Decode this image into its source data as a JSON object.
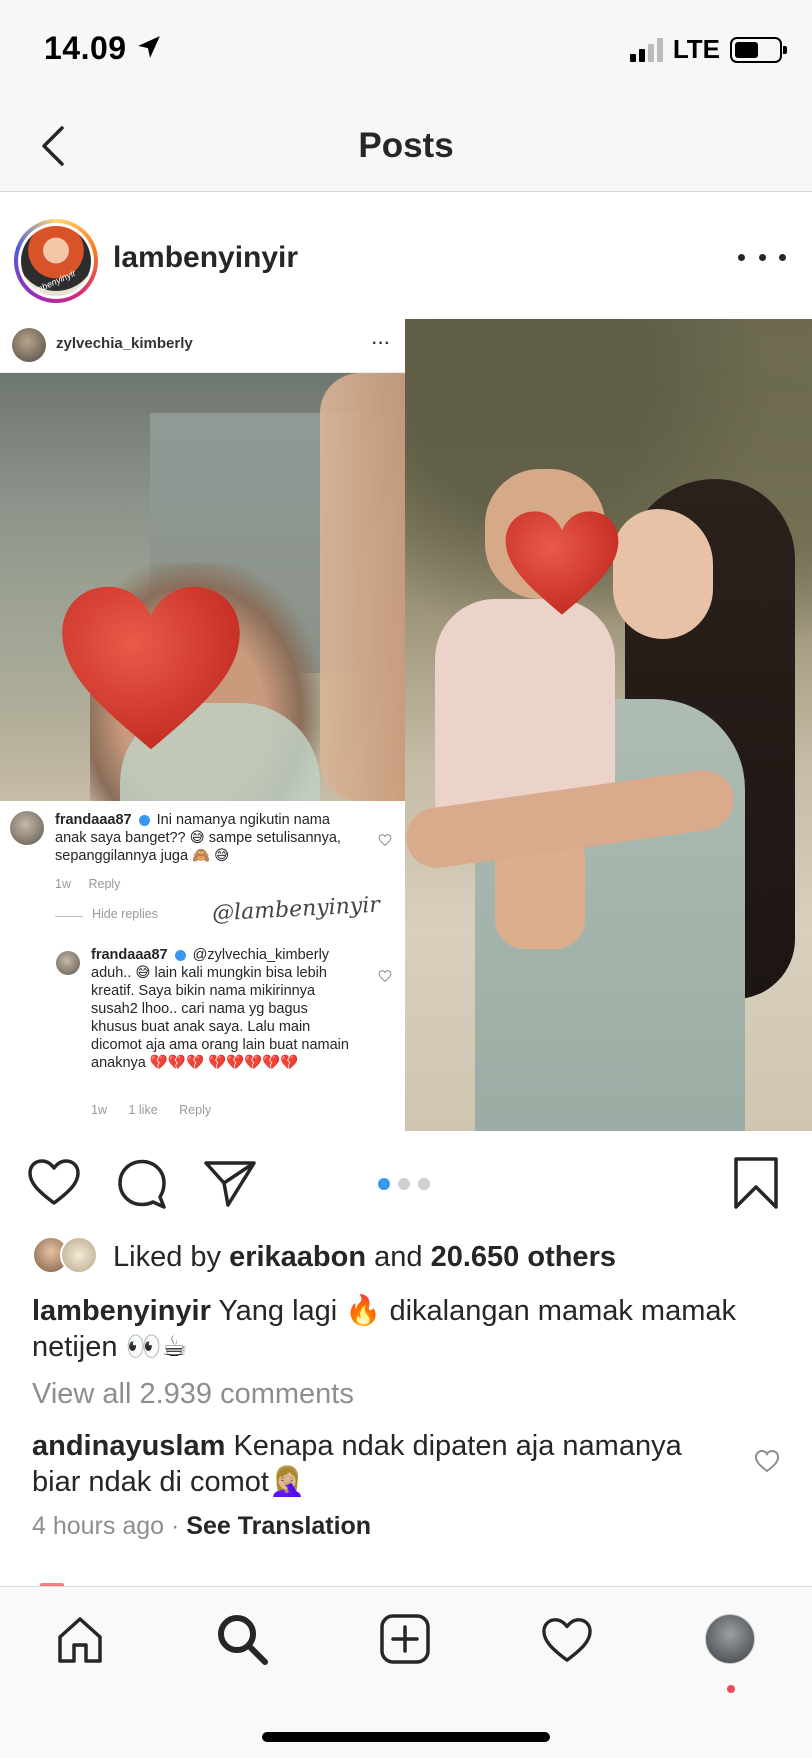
{
  "status_bar": {
    "time": "14.09",
    "network": "LTE"
  },
  "nav": {
    "title": "Posts"
  },
  "post": {
    "username": "lambenyinyir",
    "avatar_tag": "lambenyinyir",
    "media": {
      "left_panel": {
        "username": "zylvechia_kimberly",
        "more": "···",
        "comments": [
          {
            "user": "frandaaa87",
            "text": "Ini namanya ngikutin nama anak saya banget?? 😅 sampe setulisannya, sepanggilannya juga 🙈 😅",
            "time": "1w",
            "reply": "Reply"
          },
          {
            "user": "frandaaa87",
            "mention": "@zylvechia_kimberly",
            "text": "aduh.. 😅 lain kali mungkin bisa lebih kreatif. Saya bikin nama mikirinnya susah2 lhoo.. cari nama yg bagus khusus buat anak saya. Lalu main dicomot aja ama orang lain buat namain anaknya 💔💔💔 💔💔💔💔💔",
            "time": "1w",
            "likes": "1 like",
            "reply": "Reply"
          }
        ],
        "hide_replies": "Hide replies",
        "watermark": "@lambenyinyir"
      },
      "carousel": {
        "count": 3,
        "active_index": 0
      }
    },
    "likes": {
      "prefix": "Liked by",
      "user": "erikaabon",
      "joiner": "and",
      "others": "20.650 others"
    },
    "caption": {
      "user": "lambenyinyir",
      "text": "Yang lagi 🔥 dikalangan mamak mamak netijen 👀☕"
    },
    "view_all": "View all 2.939 comments",
    "top_comment": {
      "user": "andinayuslam",
      "text": "Kenapa ndak dipaten aja namanya biar ndak di comot🤦🏼‍♀️",
      "time": "4 hours ago",
      "separator": "·",
      "see_translation": "See Translation"
    }
  },
  "icons": {
    "back": "chevron-left-icon",
    "like": "heart-icon",
    "comment": "comment-bubble-icon",
    "share": "paper-plane-icon",
    "save": "bookmark-icon",
    "tabs": [
      "home-icon",
      "search-icon",
      "add-post-icon",
      "activity-heart-icon",
      "profile-avatar"
    ]
  },
  "colors": {
    "accent_blue": "#3897f0",
    "text": "#262626",
    "muted": "#8e8e8e",
    "notification_red": "#ed4956",
    "sticker_heart": "#d9352a"
  }
}
